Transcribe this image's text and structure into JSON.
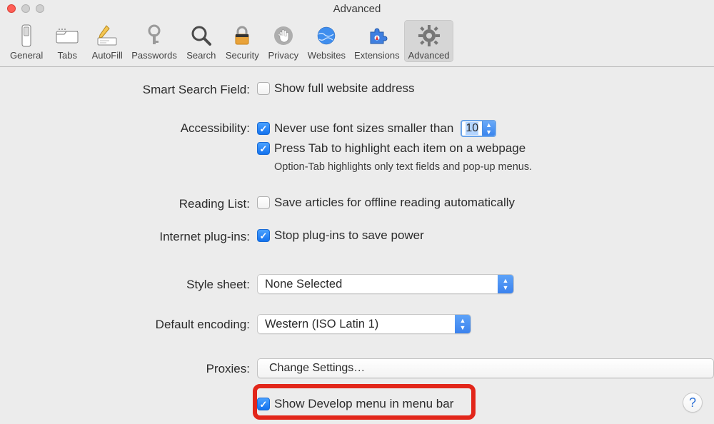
{
  "window": {
    "title": "Advanced"
  },
  "tabs": [
    {
      "label": "General"
    },
    {
      "label": "Tabs"
    },
    {
      "label": "AutoFill"
    },
    {
      "label": "Passwords"
    },
    {
      "label": "Search"
    },
    {
      "label": "Security"
    },
    {
      "label": "Privacy"
    },
    {
      "label": "Websites"
    },
    {
      "label": "Extensions"
    },
    {
      "label": "Advanced"
    }
  ],
  "labels": {
    "smart_search": "Smart Search Field:",
    "accessibility": "Accessibility:",
    "reading_list": "Reading List:",
    "plugins": "Internet plug-ins:",
    "style_sheet": "Style sheet:",
    "default_encoding": "Default encoding:",
    "proxies": "Proxies:"
  },
  "smart_search": {
    "show_full_url_label": "Show full website address",
    "show_full_url_checked": false
  },
  "accessibility": {
    "min_font_label": "Never use font sizes smaller than",
    "min_font_checked": true,
    "min_font_value": "10",
    "tab_highlight_label": "Press Tab to highlight each item on a webpage",
    "tab_highlight_checked": true,
    "hint": "Option-Tab highlights only text fields and pop-up menus."
  },
  "reading_list": {
    "offline_label": "Save articles for offline reading automatically",
    "offline_checked": false
  },
  "plugins": {
    "stop_label": "Stop plug-ins to save power",
    "stop_checked": true
  },
  "style_sheet": {
    "value": "None Selected"
  },
  "default_encoding": {
    "value": "Western (ISO Latin 1)"
  },
  "proxies": {
    "button": "Change Settings…"
  },
  "develop": {
    "label": "Show Develop menu in menu bar",
    "checked": true
  },
  "help_glyph": "?"
}
